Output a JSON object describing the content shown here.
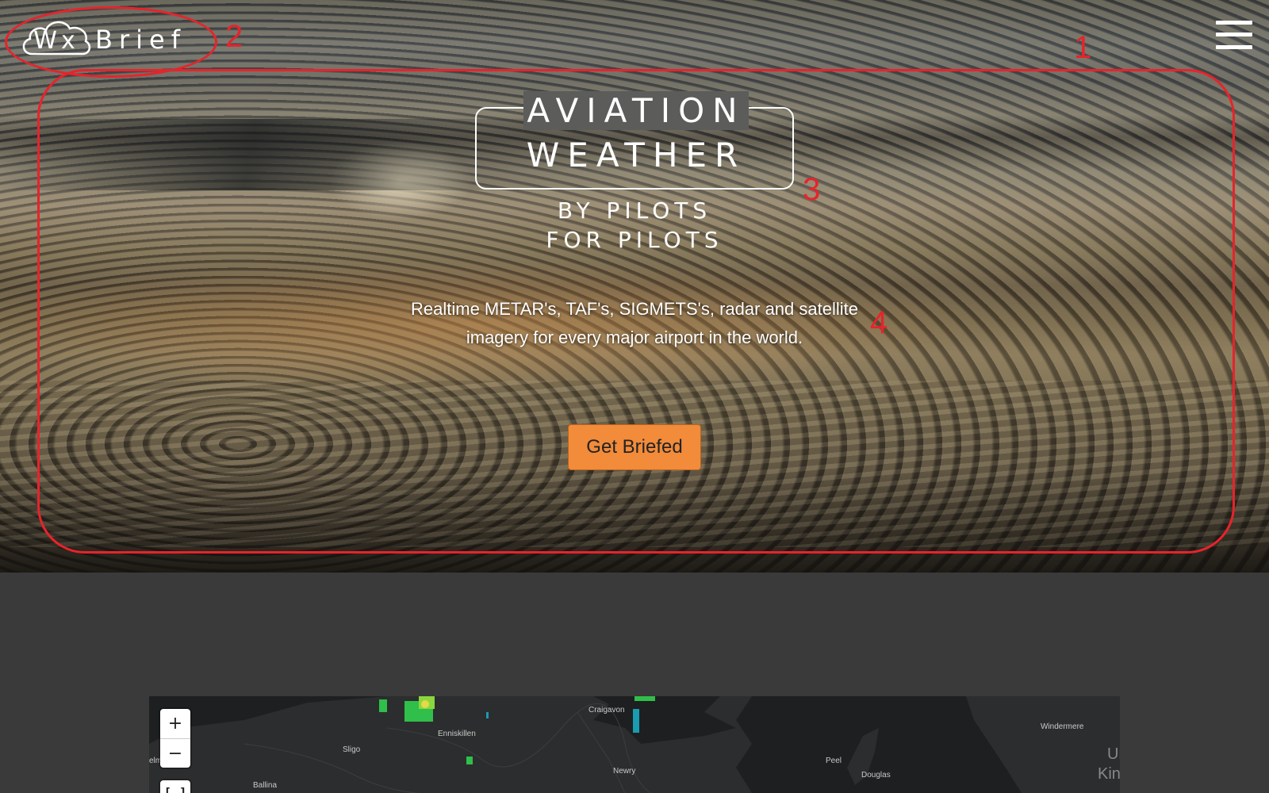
{
  "brand": {
    "logo_wx": "Wx",
    "logo_brief": "Brief"
  },
  "nav": {
    "menu_icon": "hamburger-menu-icon"
  },
  "hero": {
    "headline_line1": "AVIATION",
    "headline_line2": "WEATHER",
    "tagline_line1": "BY PILOTS",
    "tagline_line2": "FOR PILOTS",
    "description": "Realtime METAR's, TAF's, SIGMETS's, radar and satellite imagery for every major airport in the world.",
    "cta_label": "Get Briefed",
    "cta_color": "#f28b3a"
  },
  "annotations": {
    "color": "#e8232b",
    "labels": [
      "1",
      "2",
      "3",
      "4"
    ]
  },
  "map": {
    "zoom_in_label": "+",
    "zoom_out_label": "−",
    "fullscreen_label": "[ ]",
    "places": [
      "Craigavon",
      "Enniskillen",
      "Sligo",
      "Newry",
      "Ballina",
      "Peel",
      "Douglas",
      "Windermere",
      "elm",
      "Ur",
      "Kin"
    ]
  }
}
